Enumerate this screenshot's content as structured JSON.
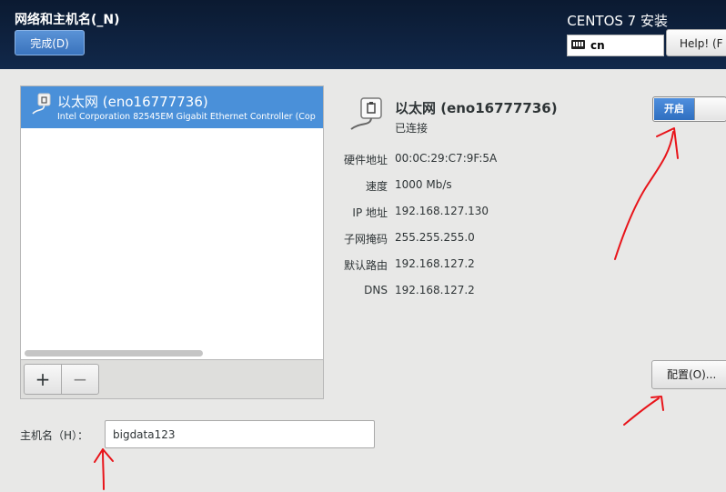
{
  "header": {
    "title": "网络和主机名(_N)",
    "done_label": "完成(D)",
    "product": "CENTOS 7 安装",
    "keyboard_layout": "cn",
    "help_label": "Help! (F"
  },
  "devices": {
    "items": [
      {
        "name": "以太网 (eno16777736)",
        "description": "Intel Corporation 82545EM Gigabit Ethernet Controller (Cop",
        "icon": "network-wired-icon"
      }
    ],
    "add_label": "+",
    "remove_label": "−"
  },
  "detail": {
    "name": "以太网 (eno16777736)",
    "status": "已连接",
    "toggle_label": "开启",
    "toggle_on": true,
    "properties": [
      {
        "label": "硬件地址",
        "value": "00:0C:29:C7:9F:5A"
      },
      {
        "label": "速度",
        "value": "1000 Mb/s"
      },
      {
        "label": "IP 地址",
        "value": "192.168.127.130"
      },
      {
        "label": "子网掩码",
        "value": "255.255.255.0"
      },
      {
        "label": "默认路由",
        "value": "192.168.127.2"
      },
      {
        "label": "DNS",
        "value": "192.168.127.2"
      }
    ],
    "configure_label": "配置(O)..."
  },
  "hostname": {
    "label": "主机名（H）：",
    "value": "bigdata123"
  },
  "colors": {
    "header_bg": "#0b1a31",
    "selection": "#4a90d9",
    "annotation": "#e8141a"
  }
}
